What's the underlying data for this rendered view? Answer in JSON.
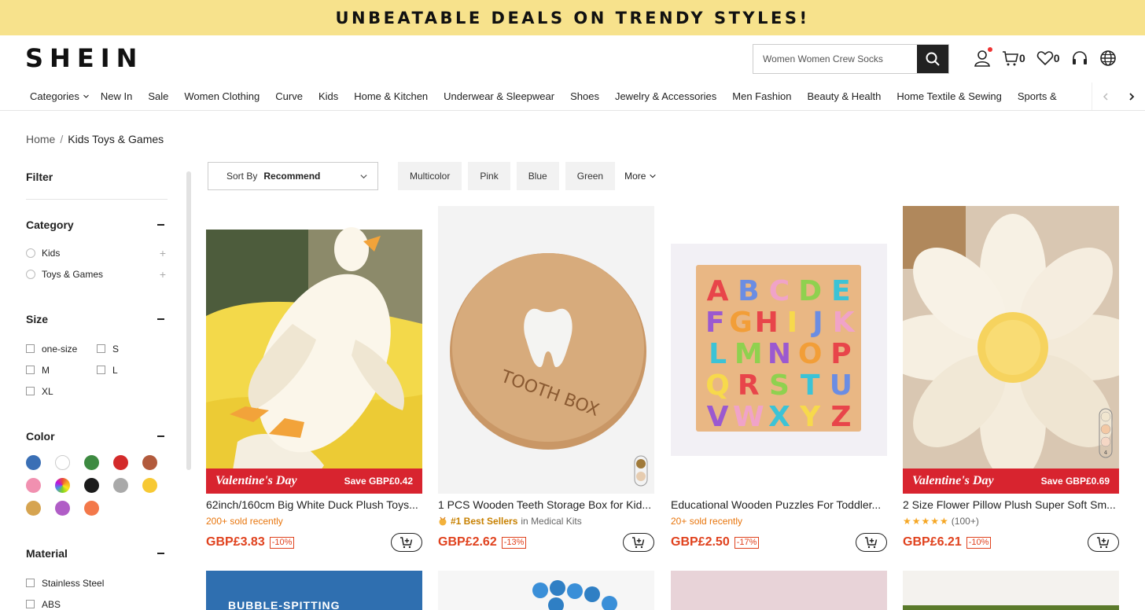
{
  "promo": {
    "text": "UNBEATABLE DEALS ON TRENDY STYLES!"
  },
  "header": {
    "logo": "SHEIN",
    "search_placeholder": "Women Women Crew Socks",
    "cart_count": "0",
    "wishlist_count": "0"
  },
  "nav": {
    "items": [
      "Categories",
      "New In",
      "Sale",
      "Women Clothing",
      "Curve",
      "Kids",
      "Home & Kitchen",
      "Underwear & Sleepwear",
      "Shoes",
      "Jewelry & Accessories",
      "Men Fashion",
      "Beauty & Health",
      "Home Textile & Sewing",
      "Sports &"
    ]
  },
  "breadcrumb": {
    "home": "Home",
    "sep": "/",
    "current": "Kids Toys & Games"
  },
  "filter": {
    "title": "Filter",
    "category": {
      "title": "Category",
      "items": [
        "Kids",
        "Toys & Games"
      ]
    },
    "size": {
      "title": "Size",
      "items": [
        "one-size",
        "S",
        "M",
        "L",
        "XL"
      ]
    },
    "color": {
      "title": "Color",
      "swatches": [
        "#3a6fb5",
        "#ffffff",
        "#3d8a41",
        "#d32a2a",
        "#b25a3c",
        "#f190b0",
        "multicolor",
        "#1b1b1b",
        "#a9a9a9",
        "#f7c934",
        "#d6a450",
        "#b05dc6",
        "#f3784a"
      ]
    },
    "material": {
      "title": "Material",
      "items": [
        "Stainless Steel",
        "ABS"
      ]
    }
  },
  "toolbar": {
    "sort_label": "Sort By",
    "sort_value": "Recommend",
    "chips": [
      "Multicolor",
      "Pink",
      "Blue",
      "Green"
    ],
    "more": "More"
  },
  "products": [
    {
      "title": "62inch/160cm Big White Duck Plush Toys...",
      "sub_type": "sold",
      "sub": "200+ sold recently",
      "price": "GBP£3.83",
      "discount": "-10%",
      "valentine": "Valentine's Day",
      "save": "Save GBP£0.42"
    },
    {
      "title": "1 PCS Wooden Teeth Storage Box for Kid...",
      "sub_type": "bestseller",
      "badge": "#1 Best Sellers",
      "badge_in": "in Medical Kits",
      "price": "GBP£2.62",
      "discount": "-13%",
      "box_text": "TOOTH BOX"
    },
    {
      "title": "Educational Wooden Puzzles For Toddler...",
      "sub_type": "sold",
      "sub": "20+ sold recently",
      "price": "GBP£2.50",
      "discount": "-17%",
      "letters": [
        "A",
        "B",
        "C",
        "D",
        "E",
        "F",
        "G",
        "H",
        "I",
        "J",
        "K",
        "L",
        "M",
        "N",
        "O",
        "P",
        "Q",
        "R",
        "S",
        "T",
        "U",
        "V",
        "W",
        "X",
        "Y",
        "Z"
      ]
    },
    {
      "title": "2 Size Flower Pillow Plush Super Soft Sm...",
      "sub_type": "rating",
      "rating": 4.5,
      "stars": "★★★★★",
      "reviews": "(100+)",
      "price": "GBP£6.21",
      "discount": "-10%",
      "valentine": "Valentine's Day",
      "save": "Save GBP£0.69",
      "variant_count": "4"
    }
  ],
  "row2": {
    "banner_text": "BUBBLE-SPITTING"
  },
  "colors": {
    "promo_bg": "#f7e28c",
    "price": "#e0421e",
    "valentine_bar": "#d8242f",
    "sold": "#e8750c"
  }
}
